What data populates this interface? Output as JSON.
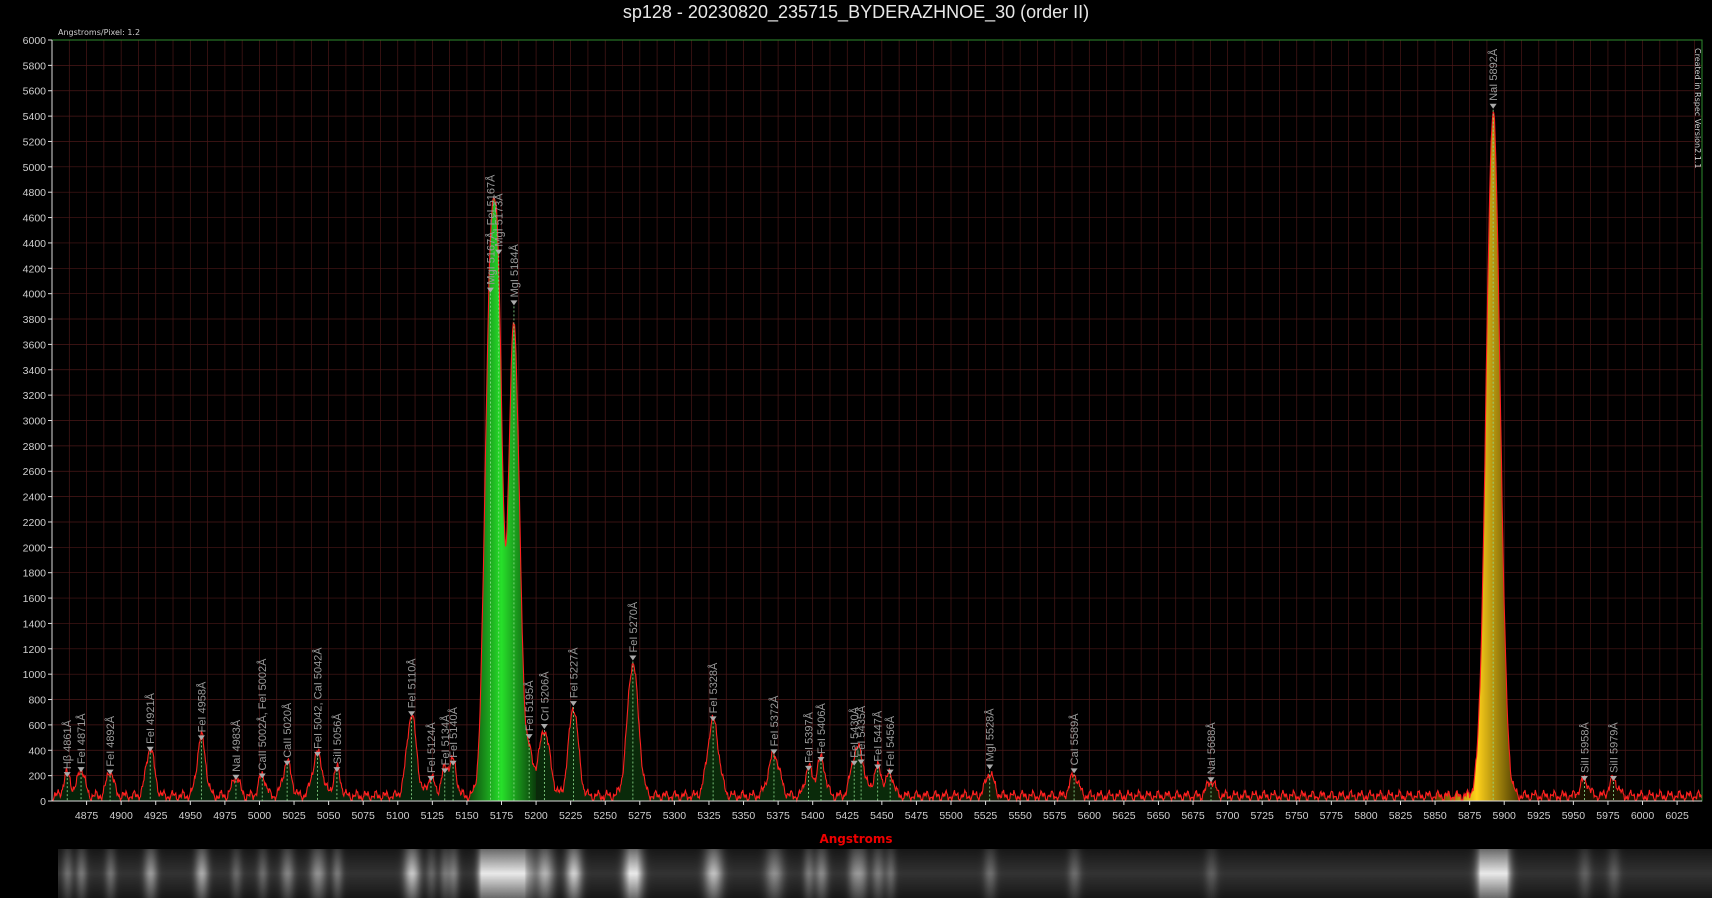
{
  "title": "sp128 - 20230820_235715_BYDERAZHNOE_30 (order II)",
  "angstroms_per_pixel": "Angstroms/Pixel: 1.2",
  "credit": "Created in Rspec Version2.1.1",
  "colors": {
    "background": "#000000",
    "grid": "#4a1818",
    "plot_border": "#2e8b2e",
    "spectrum_line": "#ff2020",
    "xlabel": "#e00000"
  },
  "chart_data": {
    "type": "line",
    "title": "sp128 - 20230820_235715_BYDERAZHNOE_30 (order II)",
    "xlabel": "Angstroms",
    "ylabel": "",
    "xlim": [
      4850,
      6043
    ],
    "ylim": [
      0,
      6000
    ],
    "grid": true,
    "xticks": [
      4875,
      4900,
      4925,
      4950,
      4975,
      5000,
      5025,
      5050,
      5075,
      5100,
      5125,
      5150,
      5175,
      5200,
      5225,
      5250,
      5275,
      5300,
      5325,
      5350,
      5375,
      5400,
      5425,
      5450,
      5475,
      5500,
      5525,
      5550,
      5575,
      5600,
      5625,
      5650,
      5675,
      5700,
      5725,
      5750,
      5775,
      5800,
      5825,
      5850,
      5875,
      5900,
      5925,
      5950,
      5975,
      6000,
      6025
    ],
    "yticks": [
      0,
      200,
      400,
      600,
      800,
      1000,
      1200,
      1400,
      1600,
      1800,
      2000,
      2200,
      2400,
      2600,
      2800,
      3000,
      3200,
      3400,
      3600,
      3800,
      4000,
      4200,
      4400,
      4600,
      4800,
      5000,
      5200,
      5400,
      5600,
      5800,
      6000
    ],
    "baseline": 40,
    "peaks": [
      {
        "x": 4861,
        "y": 180,
        "w": 2.5
      },
      {
        "x": 4871,
        "y": 220,
        "w": 2.5
      },
      {
        "x": 4892,
        "y": 200,
        "w": 2.5
      },
      {
        "x": 4921,
        "y": 380,
        "w": 3
      },
      {
        "x": 4958,
        "y": 470,
        "w": 3
      },
      {
        "x": 4983,
        "y": 160,
        "w": 2.5
      },
      {
        "x": 5002,
        "y": 170,
        "w": 2.5
      },
      {
        "x": 5020,
        "y": 270,
        "w": 3
      },
      {
        "x": 5042,
        "y": 340,
        "w": 3.5
      },
      {
        "x": 5056,
        "y": 220,
        "w": 2.5
      },
      {
        "x": 5110,
        "y": 640,
        "w": 3.5
      },
      {
        "x": 5124,
        "y": 150,
        "w": 2.5
      },
      {
        "x": 5134,
        "y": 210,
        "w": 2.5
      },
      {
        "x": 5140,
        "y": 270,
        "w": 2.5
      },
      {
        "x": 5167,
        "y": 4000,
        "w": 4
      },
      {
        "x": 5173,
        "y": 2800,
        "w": 3
      },
      {
        "x": 5184,
        "y": 3750,
        "w": 4
      },
      {
        "x": 5195,
        "y": 300,
        "w": 3
      },
      {
        "x": 5206,
        "y": 520,
        "w": 4
      },
      {
        "x": 5227,
        "y": 700,
        "w": 3.5
      },
      {
        "x": 5270,
        "y": 1050,
        "w": 4
      },
      {
        "x": 5328,
        "y": 600,
        "w": 4
      },
      {
        "x": 5372,
        "y": 330,
        "w": 4
      },
      {
        "x": 5397,
        "y": 230,
        "w": 2.5
      },
      {
        "x": 5406,
        "y": 300,
        "w": 3
      },
      {
        "x": 5430,
        "y": 260,
        "w": 3
      },
      {
        "x": 5435,
        "y": 270,
        "w": 3
      },
      {
        "x": 5447,
        "y": 230,
        "w": 3
      },
      {
        "x": 5456,
        "y": 180,
        "w": 2.5
      },
      {
        "x": 5528,
        "y": 180,
        "w": 3
      },
      {
        "x": 5589,
        "y": 170,
        "w": 3
      },
      {
        "x": 5688,
        "y": 120,
        "w": 3
      },
      {
        "x": 5892,
        "y": 5400,
        "w": 5
      },
      {
        "x": 5958,
        "y": 130,
        "w": 3
      },
      {
        "x": 5979,
        "y": 130,
        "w": 3
      }
    ],
    "annotations": [
      {
        "x": 4861,
        "y": 180,
        "label": "Hβ 4861Å"
      },
      {
        "x": 4871,
        "y": 220,
        "label": "FeI 4871Å"
      },
      {
        "x": 4892,
        "y": 200,
        "label": "FeI 4892Å"
      },
      {
        "x": 4921,
        "y": 380,
        "label": "FeI 4921Å"
      },
      {
        "x": 4958,
        "y": 470,
        "label": "FeI 4958Å"
      },
      {
        "x": 4983,
        "y": 160,
        "label": "NaI 4983Å"
      },
      {
        "x": 5002,
        "y": 170,
        "label": "CaII 5002Å, FeI 5002Å"
      },
      {
        "x": 5020,
        "y": 270,
        "label": "CaII 5020Å"
      },
      {
        "x": 5042,
        "y": 340,
        "label": "FeI 5042, CaI 5042Å"
      },
      {
        "x": 5056,
        "y": 220,
        "label": "SiII 5056Å"
      },
      {
        "x": 5110,
        "y": 660,
        "label": "FeI 5110Å"
      },
      {
        "x": 5124,
        "y": 150,
        "label": "FeI 5124Å"
      },
      {
        "x": 5134,
        "y": 210,
        "label": "FeI 5134Å"
      },
      {
        "x": 5140,
        "y": 270,
        "label": "FeI 5140Å"
      },
      {
        "x": 5167,
        "y": 4000,
        "label": "MgI 5167Å, FeI 5167Å"
      },
      {
        "x": 5173,
        "y": 4300,
        "label": "MgI 5173Å"
      },
      {
        "x": 5184,
        "y": 3900,
        "label": "MgI 5184Å"
      },
      {
        "x": 5195,
        "y": 480,
        "label": "FeI 5195Å"
      },
      {
        "x": 5206,
        "y": 560,
        "label": "CrI 5206Å"
      },
      {
        "x": 5227,
        "y": 740,
        "label": "FeI 5227Å"
      },
      {
        "x": 5270,
        "y": 1100,
        "label": "FeI 5270Å"
      },
      {
        "x": 5328,
        "y": 620,
        "label": "FeI 5328Å"
      },
      {
        "x": 5372,
        "y": 360,
        "label": "FeI 5372Å"
      },
      {
        "x": 5397,
        "y": 230,
        "label": "FeI 5397Å"
      },
      {
        "x": 5406,
        "y": 300,
        "label": "FeI 5406Å"
      },
      {
        "x": 5430,
        "y": 270,
        "label": "FeI 5430Å"
      },
      {
        "x": 5435,
        "y": 280,
        "label": "FeI 5435Å"
      },
      {
        "x": 5447,
        "y": 240,
        "label": "FeI 5447Å"
      },
      {
        "x": 5456,
        "y": 200,
        "label": "FeI 5456Å"
      },
      {
        "x": 5528,
        "y": 240,
        "label": "MgI 5528Å"
      },
      {
        "x": 5589,
        "y": 210,
        "label": "CaI 5589Å"
      },
      {
        "x": 5688,
        "y": 140,
        "label": "NaI 5688Å"
      },
      {
        "x": 5892,
        "y": 5450,
        "label": "NaI 5892Å"
      },
      {
        "x": 5958,
        "y": 150,
        "label": "SiII 5958Å"
      },
      {
        "x": 5979,
        "y": 150,
        "label": "SiII 5979Å"
      }
    ]
  }
}
